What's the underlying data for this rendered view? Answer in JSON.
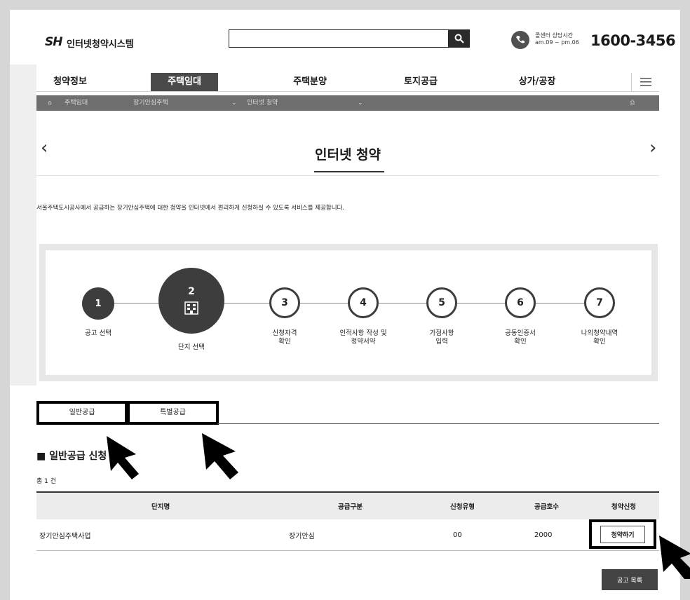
{
  "header": {
    "logo": "SH",
    "system_name": "인터넷청약시스템",
    "search_value": "",
    "call_center_label": "콜센터 상담시간",
    "call_center_hours": "am.09 ~ pm.06",
    "phone": "1600-3456"
  },
  "nav": {
    "items": [
      "청약정보",
      "주택임대",
      "주택분양",
      "토지공급",
      "상가/공장"
    ],
    "active": "주택임대"
  },
  "breadcrumb": [
    "주택임대",
    "장기안심주택",
    "인터넷 청약"
  ],
  "page": {
    "title": "인터넷 청약",
    "intro": "서울주택도시공사에서 공급하는 장기안심주택에 대한 청약을 인터넷에서 편리하게 신청하실 수 있도록 서비스를 제공합니다."
  },
  "steps": [
    {
      "num": "1",
      "label": "공고 선택"
    },
    {
      "num": "2",
      "label": "단지 선택"
    },
    {
      "num": "3",
      "label": "신청자격\n확인"
    },
    {
      "num": "4",
      "label": "인적사항 작성 및\n청약서약"
    },
    {
      "num": "5",
      "label": "가점사항\n입력"
    },
    {
      "num": "6",
      "label": "공동인증서\n확인"
    },
    {
      "num": "7",
      "label": "나의청약내역\n확인"
    }
  ],
  "tabs": [
    "일반공급",
    "특별공급"
  ],
  "section_title": "일반공급 신청",
  "total": "총 1 건",
  "table": {
    "headers": [
      "단지명",
      "공급구분",
      "신청유형",
      "공급호수",
      "청약신청"
    ],
    "rows": [
      {
        "name": "장기안심주택사업",
        "type": "장기안심",
        "apply_type": "00",
        "units": "2000",
        "action": "청약하기"
      }
    ]
  },
  "list_button": "공고 목록",
  "colors": {
    "active_nav": "#4a4a4a",
    "breadcrumb_bar": "#6e6e6e",
    "dark": "#3d3d3d"
  }
}
